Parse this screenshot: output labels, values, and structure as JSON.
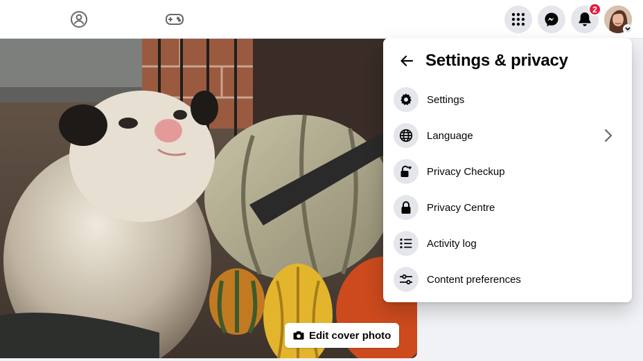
{
  "topbar": {
    "nav_icons": [
      "groups-icon",
      "gaming-icon"
    ],
    "right_buttons": [
      "menu-grid-icon",
      "messenger-icon",
      "notifications-icon"
    ],
    "notification_count": "2"
  },
  "cover": {
    "edit_label": "Edit cover photo"
  },
  "settings_panel": {
    "title": "Settings & privacy",
    "items": [
      {
        "label": "Settings",
        "icon": "gear-icon",
        "has_chevron": false
      },
      {
        "label": "Language",
        "icon": "globe-icon",
        "has_chevron": true
      },
      {
        "label": "Privacy Checkup",
        "icon": "lock-heart-icon",
        "has_chevron": false
      },
      {
        "label": "Privacy Centre",
        "icon": "lock-icon",
        "has_chevron": false
      },
      {
        "label": "Activity log",
        "icon": "list-icon",
        "has_chevron": false
      },
      {
        "label": "Content preferences",
        "icon": "sliders-icon",
        "has_chevron": false
      }
    ]
  },
  "colors": {
    "accent": "#1877f2",
    "badge": "#e41e3f",
    "icon_bg": "#e4e6eb"
  }
}
